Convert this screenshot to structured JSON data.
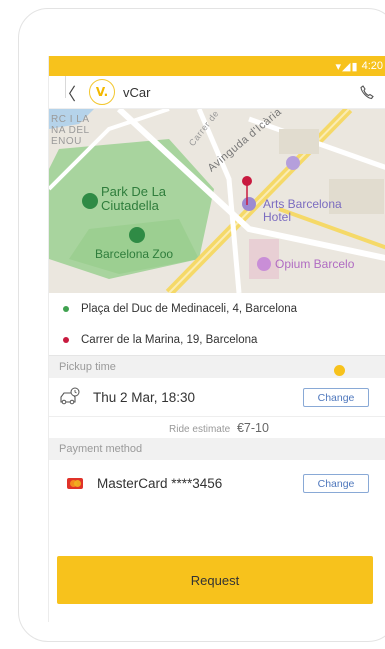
{
  "statusbar": {
    "time": "4:20",
    "icons": "▾◢▮"
  },
  "appbar": {
    "back": "〈",
    "logo": "V.",
    "title": "vCar"
  },
  "map": {
    "labels": {
      "corner1": "RC I LA",
      "corner2": "NA DEL",
      "corner3": "ENOU",
      "park1": "Park De La",
      "park2": "Ciutadella",
      "zoo": "Barcelona Zoo",
      "street1": "Avinguda d'Icària",
      "street2": "Carrer de",
      "hotel1": "Arts Barcelona",
      "hotel2": "Hotel",
      "opium": "Opium Barcelo"
    }
  },
  "route": {
    "pickup": "Plaça del Duc de Medinaceli, 4, Barcelona",
    "dropoff": "Carrer de la Marina, 19, Barcelona"
  },
  "pickup_time": {
    "header": "Pickup time",
    "value": "Thu 2 Mar, 18:30",
    "change_label": "Change"
  },
  "estimate": {
    "label": "Ride estimate",
    "value": "€7-10"
  },
  "payment": {
    "header": "Payment method",
    "value": "MasterCard ****3456",
    "change_label": "Change"
  },
  "request_label": "Request",
  "colors": {
    "accent": "#f7c21c",
    "link": "#4f78bd",
    "pickup_dot": "#3fa14f",
    "dropoff_dot": "#c81a3f"
  }
}
